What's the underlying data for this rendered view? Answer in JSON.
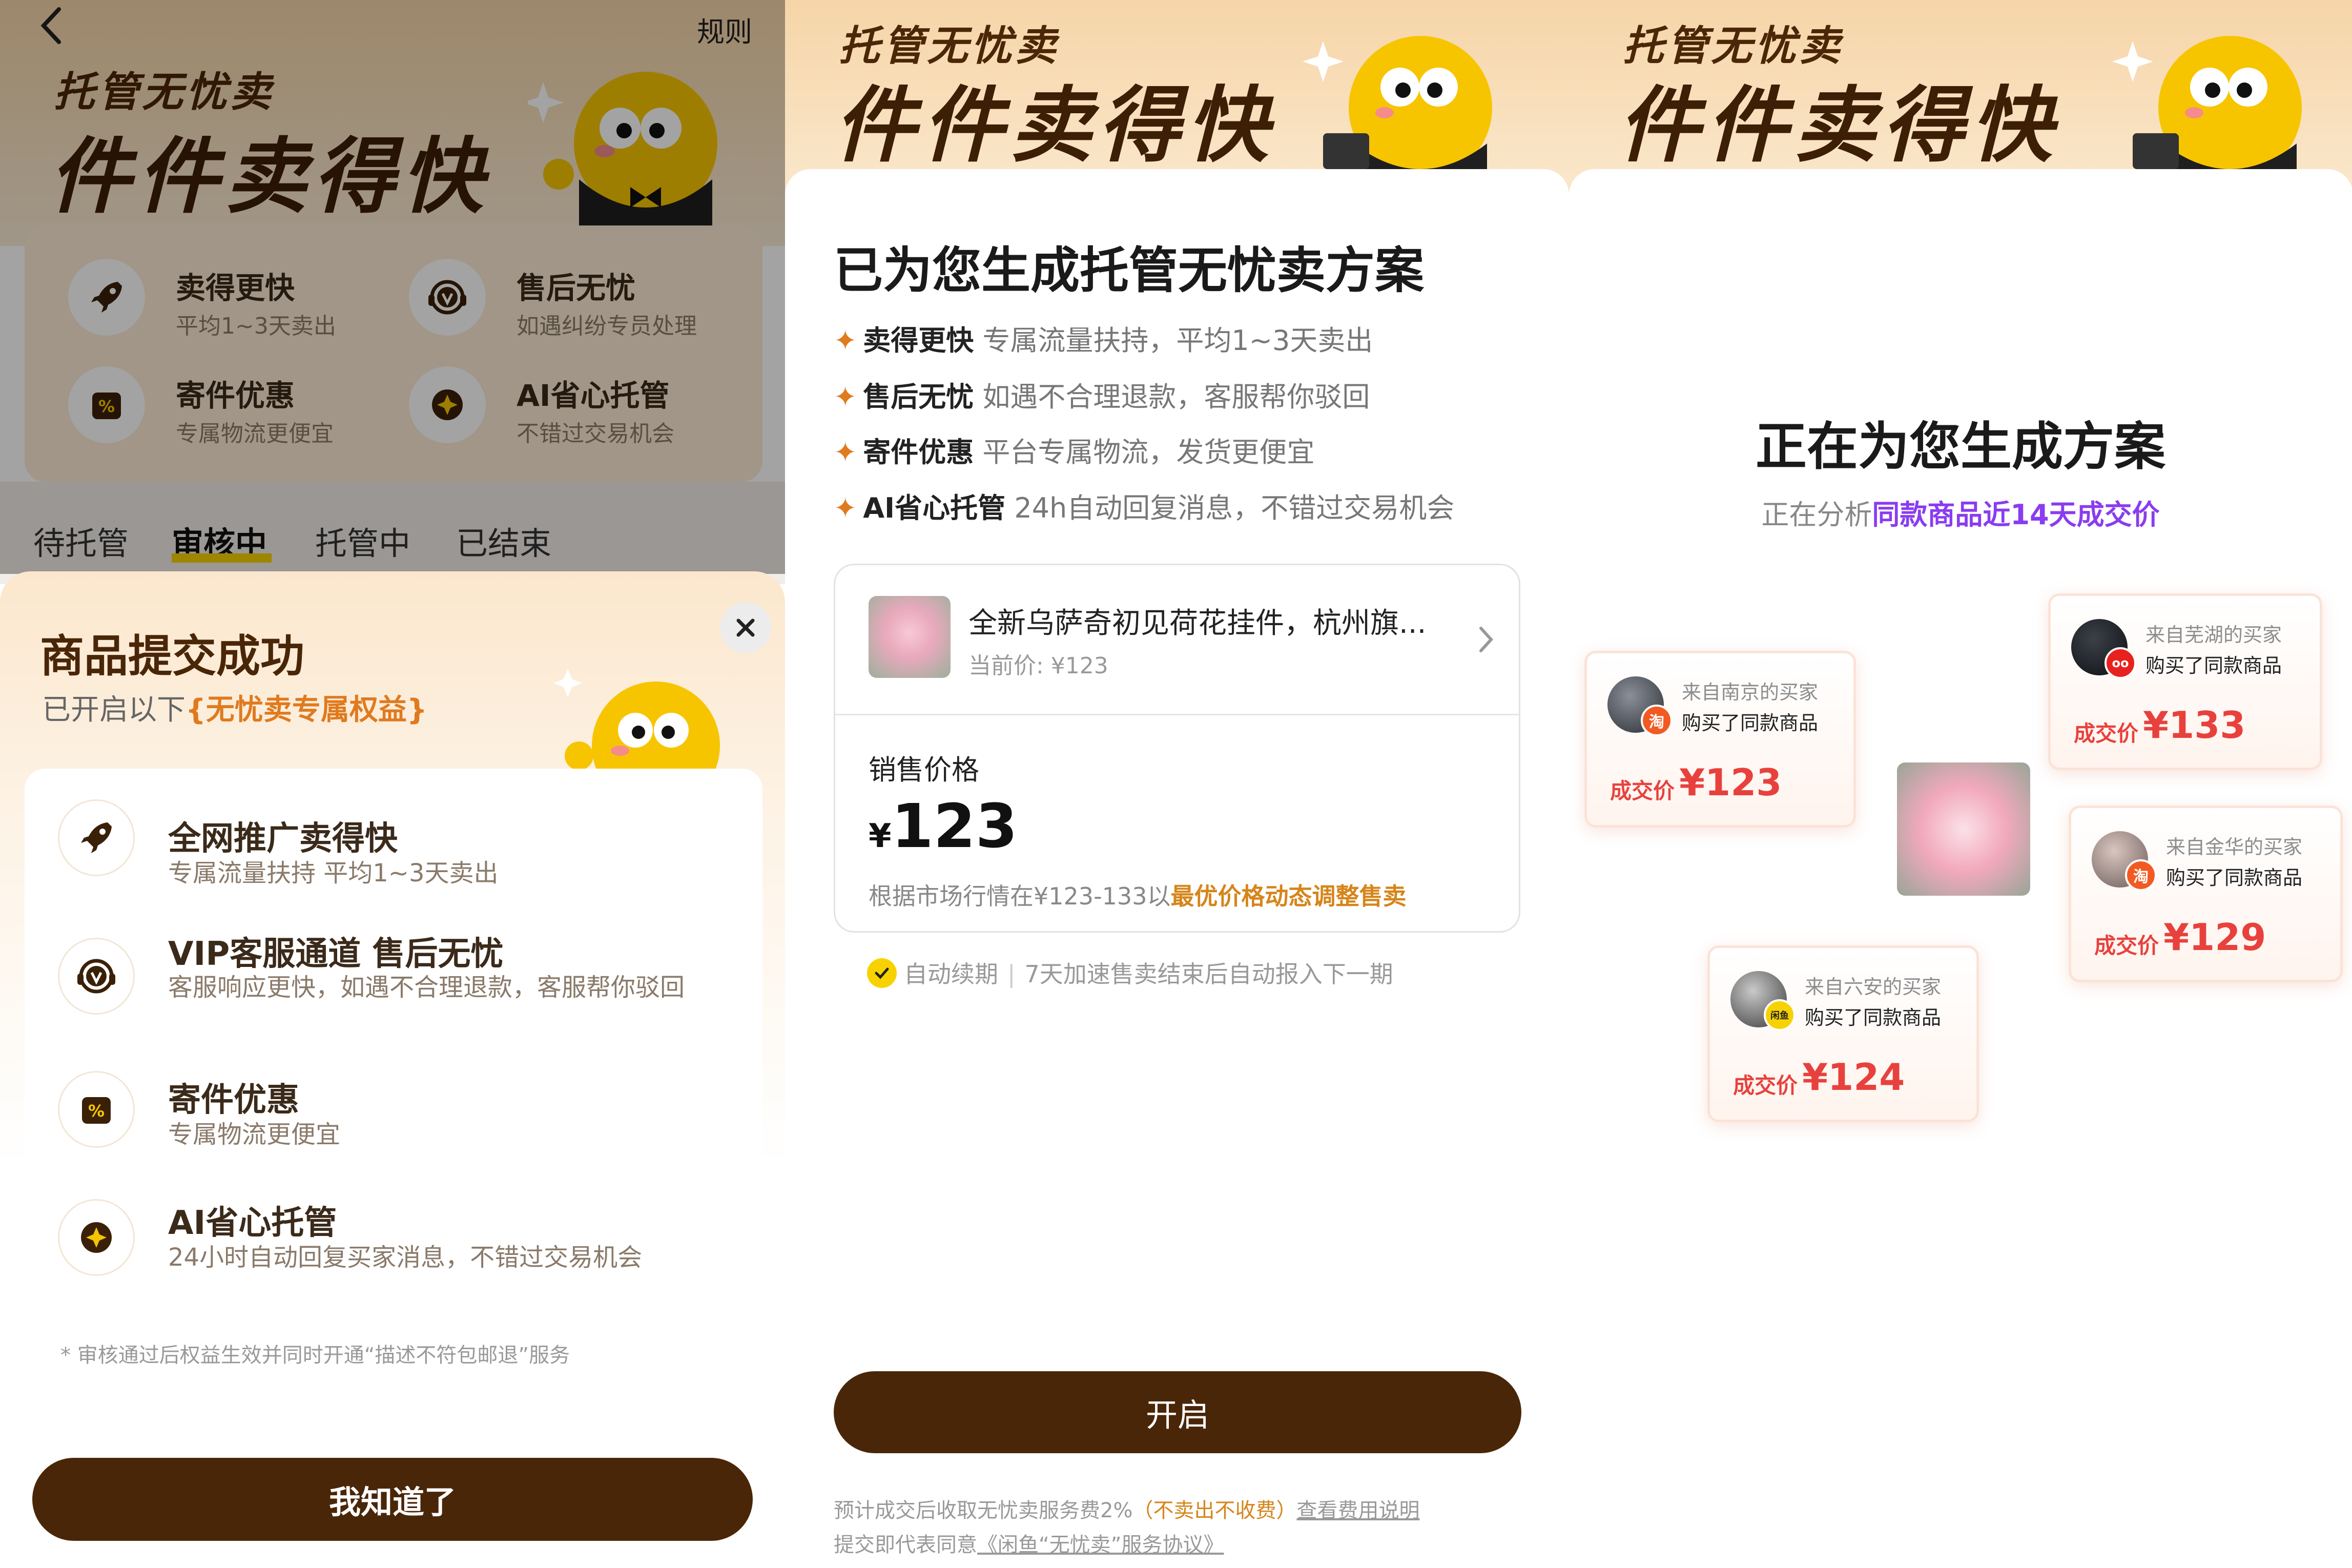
{
  "panel1": {
    "header": {
      "back_icon": "chevron-left-icon",
      "rules_label": "规则",
      "brand_small": "托管无忧卖",
      "brand_big": "件件卖得快"
    },
    "benefits": [
      {
        "title": "卖得更快",
        "subtitle": "平均1~3天卖出",
        "icon": "rocket-icon"
      },
      {
        "title": "售后无忧",
        "subtitle": "如遇纠纷专员处理",
        "icon": "headset-icon"
      },
      {
        "title": "寄件优惠",
        "subtitle": "专属物流更便宜",
        "icon": "coupon-icon"
      },
      {
        "title": "AI省心托管",
        "subtitle": "不错过交易机会",
        "icon": "ai-sparkle-icon"
      }
    ],
    "tabs": [
      "待托管",
      "审核中",
      "托管中",
      "已结束"
    ],
    "active_tab": "审核中",
    "sheet": {
      "title": "商品提交成功",
      "subtitle_prefix": "已开启以下",
      "subtitle_highlight": "{无忧卖专属权益}",
      "close_icon": "close-icon",
      "items": [
        {
          "title": "全网推广卖得快",
          "desc": "专属流量扶持 平均1~3天卖出",
          "icon": "rocket-icon"
        },
        {
          "title": "VIP客服通道 售后无忧",
          "desc": "客服响应更快，如遇不合理退款，客服帮你驳回",
          "icon": "headset-icon"
        },
        {
          "title": "寄件优惠",
          "desc": "专属物流更便宜",
          "icon": "coupon-icon"
        },
        {
          "title": "AI省心托管",
          "desc": "24小时自动回复买家消息，不错过交易机会",
          "icon": "ai-sparkle-icon"
        }
      ],
      "footnote": "* 审核通过后权益生效并同时开通“描述不符包邮退”服务",
      "button_label": "我知道了"
    }
  },
  "panel2": {
    "brand_small": "托管无忧卖",
    "brand_big": "件件卖得快",
    "title": "已为您生成托管无忧卖方案",
    "bullets": [
      {
        "name": "卖得更快",
        "desc": "专属流量扶持，平均1~3天卖出"
      },
      {
        "name": "售后无忧",
        "desc": "如遇不合理退款，客服帮你驳回"
      },
      {
        "name": "寄件优惠",
        "desc": "平台专属物流，发货更便宜"
      },
      {
        "name": "AI省心托管",
        "desc": "24h自动回复消息，不错过交易机会"
      }
    ],
    "product": {
      "name": "全新乌萨奇初见荷花挂件，杭州旗...",
      "current_price": "当前价: ¥123"
    },
    "price_section": {
      "label": "销售价格",
      "currency": "¥",
      "value": "123",
      "note_prefix": "根据市场行情在¥123-133以",
      "note_highlight": "最优价格动态调整售卖"
    },
    "auto_renew": {
      "label": "自动续期",
      "desc": "7天加速售卖结束后自动报入下一期"
    },
    "button_label": "开启",
    "fee_line": {
      "prefix": "预计成交后收取无忧卖服务费2%",
      "highlight": "（不卖出不收费）",
      "link": "查看费用说明"
    },
    "agreement_line": {
      "prefix": "提交即代表同意",
      "link": "《闲鱼“无忧卖”服务协议》"
    }
  },
  "panel3": {
    "brand_small": "托管无忧卖",
    "brand_big": "件件卖得快",
    "title": "正在为您生成方案",
    "subtitle_prefix": "正在分析",
    "subtitle_highlight": "同款商品近14天成交价",
    "buyers": [
      {
        "from": "来自南京的买家",
        "bought": "购买了同款商品",
        "price_label": "成交价",
        "price": "¥123",
        "platform": "淘"
      },
      {
        "from": "来自芜湖的买家",
        "bought": "购买了同款商品",
        "price_label": "成交价",
        "price": "¥133",
        "platform": "oo"
      },
      {
        "from": "来自金华的买家",
        "bought": "购买了同款商品",
        "price_label": "成交价",
        "price": "¥129",
        "platform": "淘"
      },
      {
        "from": "来自六安的买家",
        "bought": "购买了同款商品",
        "price_label": "成交价",
        "price": "¥124",
        "platform": "闲鱼"
      }
    ]
  },
  "colors": {
    "brand_dark": "#4a2608",
    "accent_orange": "#e07a1f",
    "price_red": "#e8413d",
    "highlight_purple": "#8a3cf0"
  }
}
